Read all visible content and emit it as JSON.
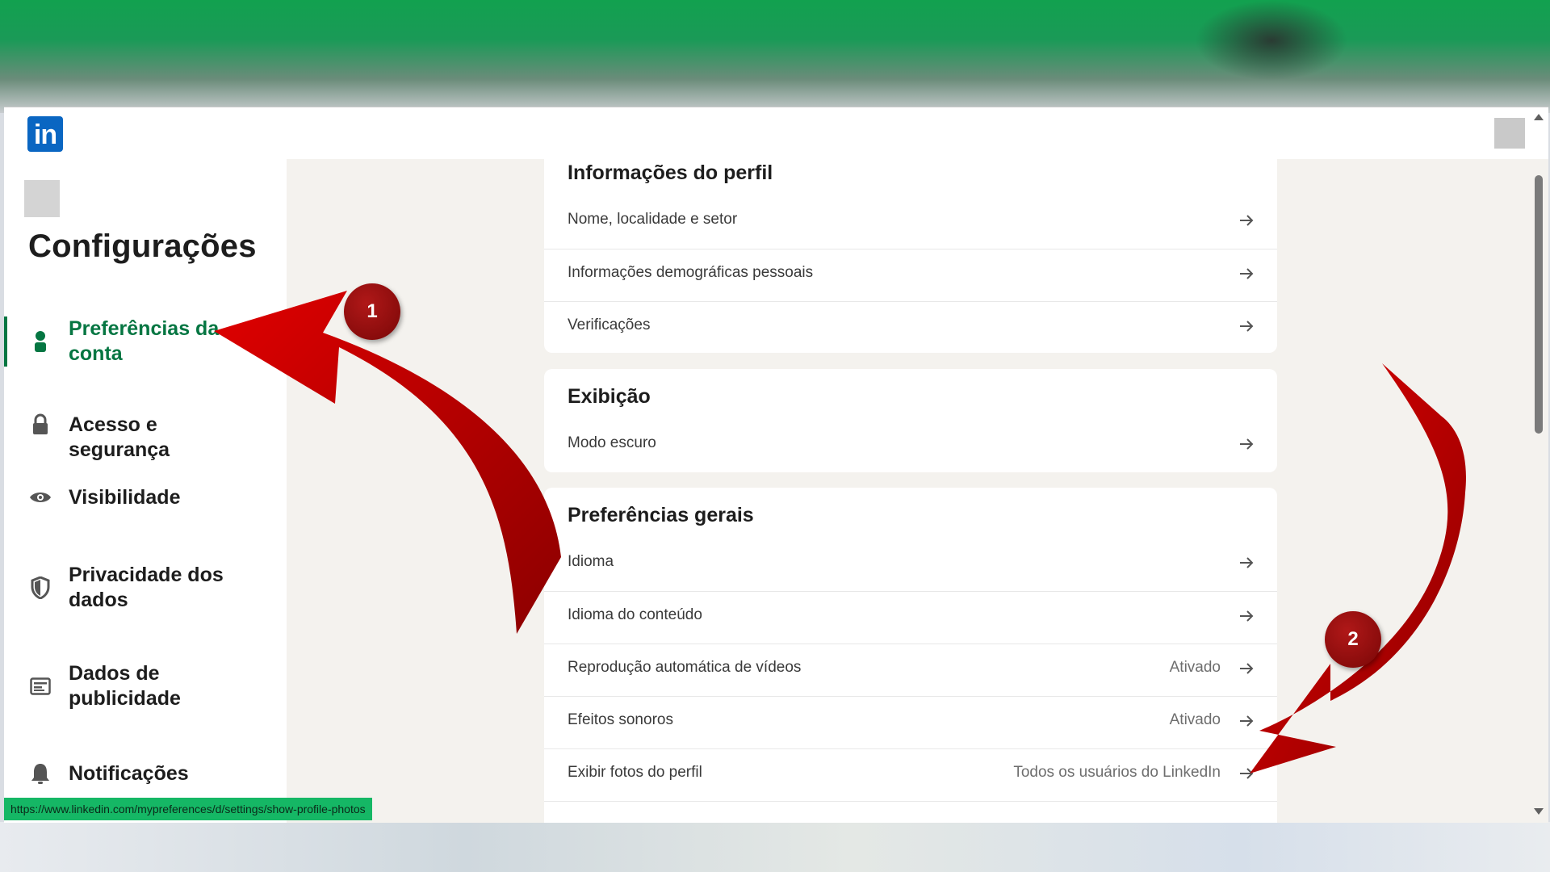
{
  "app": {
    "logo_text": "in",
    "brand_color": "#0a66c2",
    "accent_color": "#057642"
  },
  "sidebar": {
    "title": "Configurações",
    "items": [
      {
        "label": "Preferências da conta",
        "icon": "person-icon",
        "active": true
      },
      {
        "label": "Acesso e segurança",
        "icon": "lock-icon",
        "active": false
      },
      {
        "label": "Visibilidade",
        "icon": "eye-icon",
        "active": false
      },
      {
        "label": "Privacidade dos dados",
        "icon": "shield-icon",
        "active": false
      },
      {
        "label": "Dados de publicidade",
        "icon": "ad-card-icon",
        "active": false
      },
      {
        "label": "Notificações",
        "icon": "bell-icon",
        "active": false
      }
    ]
  },
  "sections": [
    {
      "title": "Informações do perfil",
      "rows": [
        {
          "label": "Nome, localidade e setor",
          "value": ""
        },
        {
          "label": "Informações demográficas pessoais",
          "value": ""
        },
        {
          "label": "Verificações",
          "value": ""
        }
      ]
    },
    {
      "title": "Exibição",
      "rows": [
        {
          "label": "Modo escuro",
          "value": ""
        }
      ]
    },
    {
      "title": "Preferências gerais",
      "rows": [
        {
          "label": "Idioma",
          "value": ""
        },
        {
          "label": "Idioma do conteúdo",
          "value": ""
        },
        {
          "label": "Reprodução automática de vídeos",
          "value": "Ativado"
        },
        {
          "label": "Efeitos sonoros",
          "value": "Ativado"
        },
        {
          "label": "Exibir fotos do perfil",
          "value": "Todos os usuários do LinkedIn"
        }
      ]
    }
  ],
  "status_bar": {
    "url": "https://www.linkedin.com/mypreferences/d/settings/show-profile-photos"
  },
  "annotations": {
    "badge_1": "1",
    "badge_2": "2",
    "arrow_color": "#d40000"
  }
}
